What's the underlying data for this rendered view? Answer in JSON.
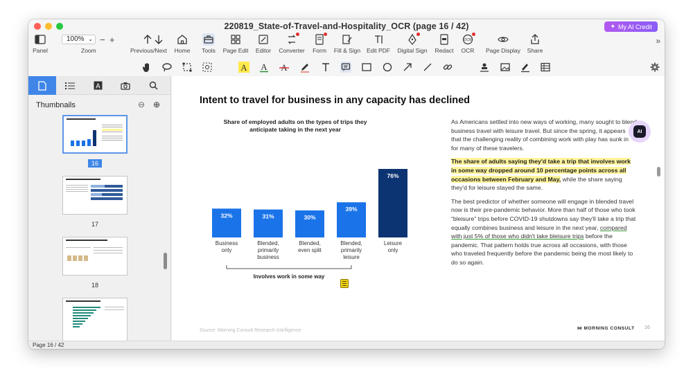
{
  "window": {
    "title": "220819_State-of-Travel-and-Hospitality_OCR (page 16 / 42)",
    "ai_credit_label": "My AI Credit"
  },
  "toolbar": {
    "panel": "Panel",
    "zoom_value": "100%",
    "zoom": "Zoom",
    "zoom_minus": "−",
    "zoom_plus": "+",
    "prev_next": "Previous/Next",
    "home": "Home",
    "tools": "Tools",
    "page_edit": "Page Edit",
    "editor": "Editor",
    "converter": "Converter",
    "form": "Form",
    "fill_sign": "Fill & Sign",
    "edit_pdf": "Edit PDF",
    "digital_sign": "Digital Sign",
    "redact": "Redact",
    "ocr": "OCR",
    "page_display": "Page Display",
    "share": "Share",
    "more": "»"
  },
  "sidebar": {
    "heading": "Thumbnails",
    "thumbnails": [
      {
        "label": "16"
      },
      {
        "label": "17"
      },
      {
        "label": "18"
      }
    ]
  },
  "page": {
    "title": "Intent to travel for business in any capacity has declined",
    "source": "Source: Morning Consult Research Intelligence",
    "brand": "MORNING CONSULT",
    "page_number": "16",
    "paragraph1": "As Americans settled into new ways of working, many sought to blend business travel with leisure travel. But since the spring, it appears that the challenging reality of combining work with play has sunk in for many of these travelers.",
    "paragraph2_highlight": "The share of adults saying they'd take a trip that involves work in some way dropped around 10 percentage points across all occasions between February and May,",
    "paragraph2_rest": " while the share saying they'd for leisure stayed the same.",
    "paragraph3_a": "The best predictor of whether someone will engage in blended travel now is their pre-pandemic behavior. More than half of those who took “bleisure” trips before COVID-19 shutdowns say they'll take a trip that equally combines business and leisure in the next year, ",
    "paragraph3_underline": "compared with just 5% of those who didn't take bleisure trips",
    "paragraph3_b": " before the pandemic. That pattern holds true across all occasions, with those who traveled frequently before the pandemic being the most likely to do so again."
  },
  "status": {
    "page_indicator": "Page 16 / 42"
  },
  "colors": {
    "bar_blue": "#1a73e8",
    "bar_navy": "#0d3472",
    "accent": "#3f86e8"
  },
  "chart_data": {
    "type": "bar",
    "title": "Share of employed adults on the types of trips they anticipate taking in the next year",
    "categories": [
      "Business only",
      "Blended, primarily business",
      "Blended, even split",
      "Blended, primarily leisure",
      "Leisure only"
    ],
    "values": [
      32,
      31,
      30,
      39,
      76
    ],
    "value_labels": [
      "32%",
      "31%",
      "30%",
      "39%",
      "76%"
    ],
    "ylim": [
      0,
      76
    ],
    "bracket_label": "Involves work in some way"
  }
}
